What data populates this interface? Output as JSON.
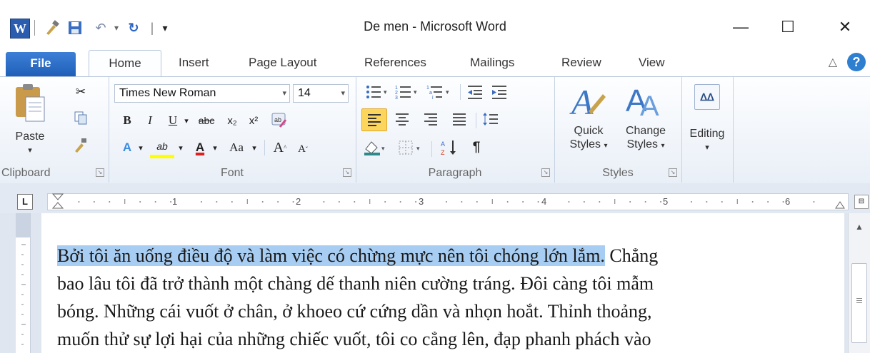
{
  "window": {
    "title": "De men - Microsoft Word"
  },
  "qat": {
    "undo_symbol": "↶",
    "redo_symbol": "↻",
    "separator": "|",
    "customize": "▾"
  },
  "window_controls": {
    "minimize": "—",
    "maximize": "☐",
    "close": "✕"
  },
  "tabs": [
    {
      "label": "File"
    },
    {
      "label": "Home"
    },
    {
      "label": "Insert"
    },
    {
      "label": "Page Layout"
    },
    {
      "label": "References"
    },
    {
      "label": "Mailings"
    },
    {
      "label": "Review"
    },
    {
      "label": "View"
    }
  ],
  "help": {
    "label": "?",
    "minimize_ribbon": "△"
  },
  "ribbon": {
    "clipboard": {
      "label": "Clipboard",
      "paste": "Paste",
      "paste_arrow": "▾"
    },
    "font": {
      "label": "Font",
      "font_name": "Times New Roman",
      "font_size": "14",
      "bold": "B",
      "italic": "I",
      "underline": "U",
      "strike": "abc",
      "subscript": "x₂",
      "superscript": "x²",
      "text_effects": "A",
      "highlight": "ab",
      "font_color": "A",
      "change_case": "Aa",
      "grow": "A",
      "shrink": "A"
    },
    "paragraph": {
      "label": "Paragraph",
      "show_marks": "¶"
    },
    "styles": {
      "label": "Styles",
      "quick_styles": [
        "Quick",
        "Styles"
      ],
      "change_styles": [
        "Change",
        "Styles"
      ]
    },
    "editing": {
      "label": "Editing",
      "arrow": "▾"
    }
  },
  "ruler": {
    "numbers": [
      "1",
      "2",
      "3",
      "4",
      "5",
      "6"
    ]
  },
  "document": {
    "selected_text": "Bởi tôi ăn uống điều độ và làm việc có chừng mực nên tôi chóng lớn lắm.",
    "rest_line1": " Chẳng",
    "line2": "bao lâu tôi đã trở thành một chàng dế thanh niên cường tráng. Đôi càng tôi mẫm",
    "line3": "bóng. Những cái vuốt ở chân, ở khoeo cứ cứng dần và nhọn hoắt. Thỉnh thoảng,",
    "line4": "muốn thử sự lợi hại của những chiếc vuốt, tôi co cẳng lên, đạp phanh phách vào"
  },
  "colors": {
    "accent": "#2b579a",
    "file_tab": "#2f6cc4",
    "selection": "#a8cdf2",
    "ribbon_bg": "#eef3fa"
  }
}
